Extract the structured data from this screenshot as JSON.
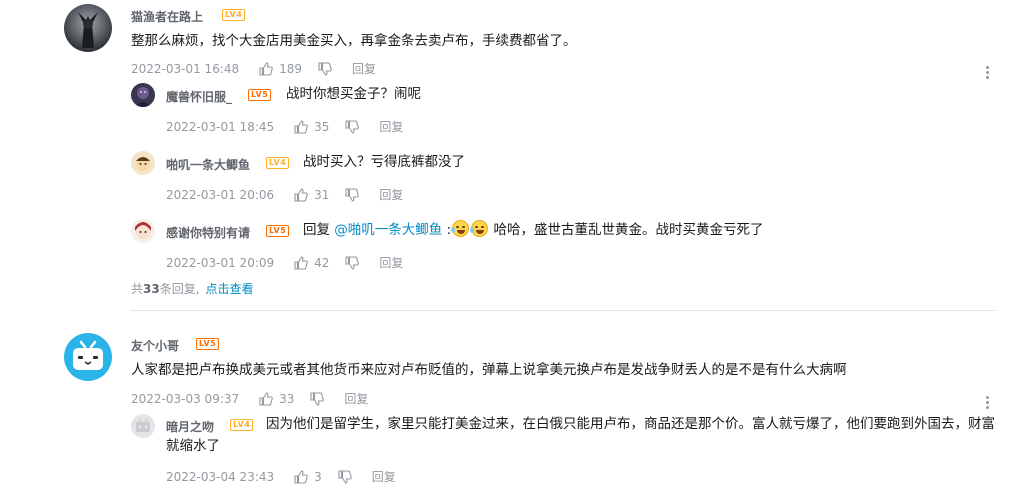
{
  "thread1": {
    "user": "猫渔者在路上",
    "level": "LV4",
    "text": "整那么麻烦，找个大金店用美金买入，再拿金条去卖卢布，手续费都省了。",
    "time": "2022-03-01 16:48",
    "likes": "189",
    "reply_label": "回复",
    "replies": [
      {
        "user": "魔兽怀旧服_",
        "level": "LV5",
        "text": "战时你想买金子？闹呢",
        "time": "2022-03-01 18:45",
        "likes": "35",
        "reply_label": "回复"
      },
      {
        "user": "啪叽一条大鲫鱼",
        "level": "LV4",
        "text": "战时买入？亏得底裤都没了",
        "time": "2022-03-01 20:06",
        "likes": "31",
        "reply_label": "回复"
      },
      {
        "user": "感谢你特别有请",
        "level": "LV5",
        "prefix": "回复",
        "mention": "@啪叽一条大鲫鱼",
        "colon": ":",
        "text": "哈哈，盛世古董乱世黄金。战时买黄金亏死了",
        "time": "2022-03-01 20:09",
        "likes": "42",
        "reply_label": "回复"
      }
    ],
    "summary_pre": "共",
    "summary_count": "33",
    "summary_post": "条回复,",
    "summary_link": "点击查看"
  },
  "thread2": {
    "user": "友个小哥",
    "level": "LV5",
    "text": "人家都是把卢布换成美元或者其他货币来应对卢布贬值的，弹幕上说拿美元换卢布是发战争财丢人的是不是有什么大病啊",
    "time": "2022-03-03 09:37",
    "likes": "33",
    "reply_label": "回复",
    "replies": [
      {
        "user": "暗月之吻",
        "level": "LV4",
        "text": "因为他们是留学生，家里只能打美金过来，在白俄只能用卢布，商品还是那个价。富人就亏爆了，他们要跑到外国去，财富就缩水了",
        "time": "2022-03-04 23:43",
        "likes": "3",
        "reply_label": "回复"
      }
    ]
  },
  "icons": {
    "like": "thumbs-up-icon",
    "dislike": "thumbs-down-icon",
    "more": "more-vertical-icon"
  },
  "colors": {
    "link": "#008ac5",
    "meta": "#9499a0",
    "lv4": "#ffb027",
    "lv5": "#ff6c00"
  }
}
